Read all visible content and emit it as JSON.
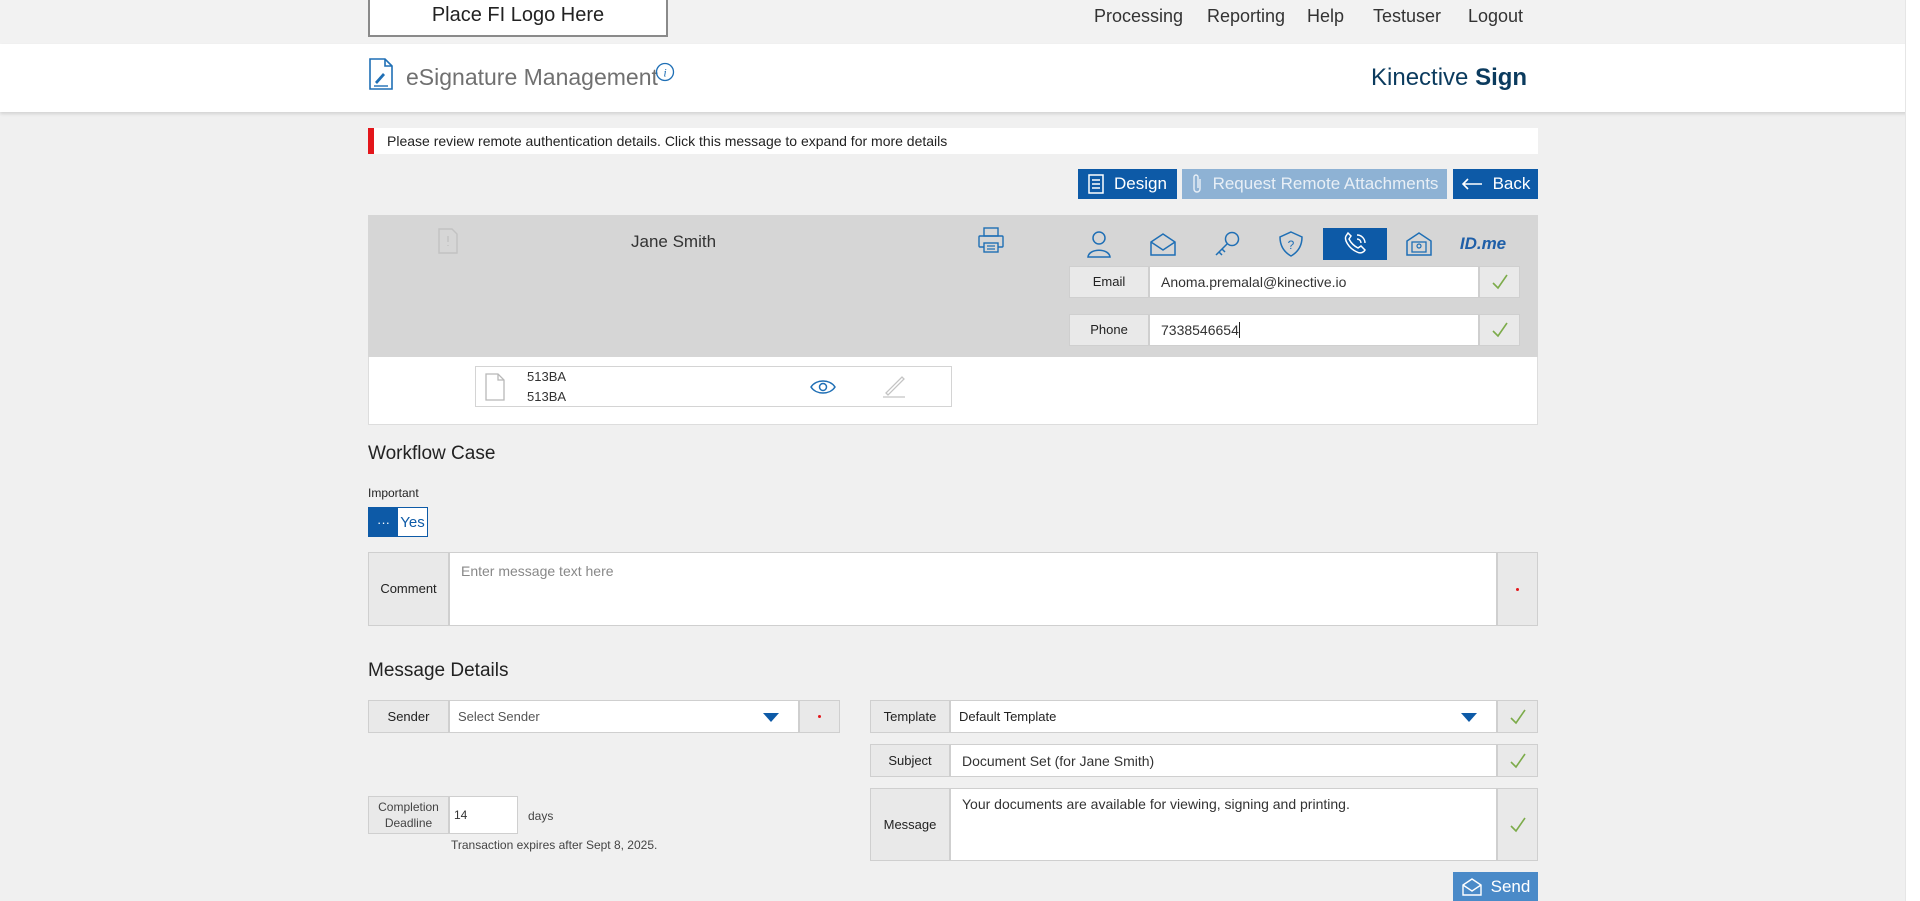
{
  "top_nav": {
    "logo_placeholder": "Place FI Logo Here",
    "items": [
      "Processing",
      "Reporting",
      "Help",
      "Testuser",
      "Logout"
    ]
  },
  "header": {
    "title": "eSignature Management",
    "brand_light": "Kinective ",
    "brand_bold": "Sign"
  },
  "alert": {
    "message": "Please review remote authentication details. Click this message to expand for more details"
  },
  "actions": {
    "design": "Design",
    "request_attachments": "Request Remote Attachments",
    "back": "Back"
  },
  "signer": {
    "name": "Jane Smith",
    "auth_methods": [
      "person-icon",
      "email-icon",
      "key-icon",
      "shield-question-icon",
      "phone-icon",
      "id-card-icon",
      "idme-icon"
    ],
    "auth_active": "phone-icon",
    "idme_label": "ID.me",
    "email_label": "Email",
    "email_value": "Anoma.premalal@kinective.io",
    "phone_label": "Phone",
    "phone_value": "7338546654",
    "document": {
      "line1": "513BA",
      "line2": "513BA"
    }
  },
  "workflow": {
    "title": "Workflow Case",
    "important_label": "Important",
    "toggle_off": "···",
    "toggle_on": "Yes",
    "comment_label": "Comment",
    "comment_placeholder": "Enter message text here"
  },
  "message": {
    "title": "Message Details",
    "sender_label": "Sender",
    "sender_placeholder": "Select Sender",
    "template_label": "Template",
    "template_value": "Default Template",
    "subject_label": "Subject",
    "subject_value": "Document Set (for Jane Smith)",
    "message_label": "Message",
    "message_value": "Your documents are available for viewing, signing and printing.",
    "deadline_label_1": "Completion",
    "deadline_label_2": "Deadline",
    "deadline_value": "14",
    "deadline_unit": "days",
    "expiry_note": "Transaction expires after Sept 8, 2025.",
    "send": "Send"
  },
  "colors": {
    "primary": "#0d5aa7",
    "primary_disabled": "#8eb2d4",
    "alert_red": "#e3161b",
    "check_green": "#7cab4a"
  }
}
